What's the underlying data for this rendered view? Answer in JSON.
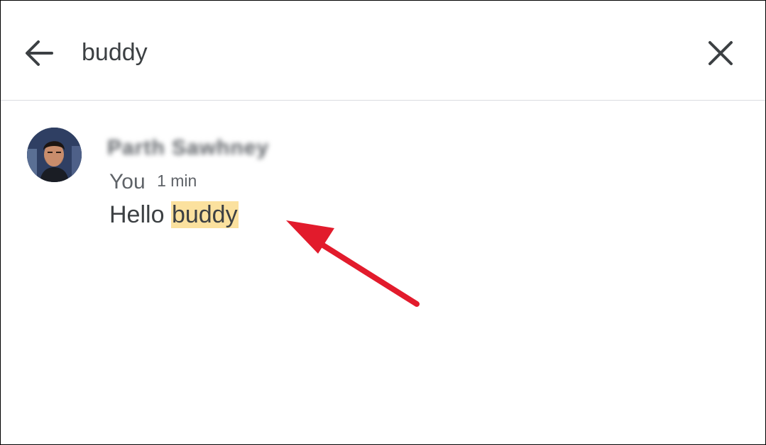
{
  "search": {
    "query": "buddy",
    "back_icon": "arrow-back-icon",
    "clear_icon": "close-icon"
  },
  "results": [
    {
      "sender_name": "Parth Sawhney",
      "sender_label": "You",
      "timestamp": "1 min",
      "message_prefix": "Hello ",
      "message_match": "buddy"
    }
  ],
  "colors": {
    "highlight": "#fbe19e",
    "annotation_arrow": "#e21b2c",
    "divider": "#dadce0"
  }
}
